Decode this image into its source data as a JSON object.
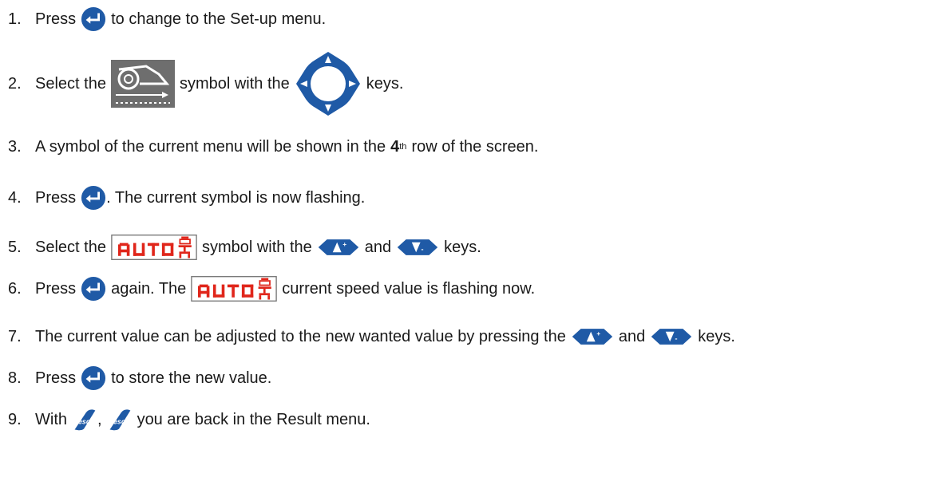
{
  "steps": [
    {
      "num": "1.",
      "a": "Press",
      "b": "to change to the Set-up menu."
    },
    {
      "num": "2.",
      "a": "Select the",
      "b": "symbol with the",
      "c": "keys."
    },
    {
      "num": "3.",
      "a": "A symbol of the current menu will be shown in the",
      "b": "4",
      "c": "th",
      "d": "row of the screen."
    },
    {
      "num": "4.",
      "a": "Press",
      "b": ". The current symbol is now flashing."
    },
    {
      "num": "5.",
      "a": "Select the",
      "b": "symbol with the",
      "c": "and",
      "d": "keys."
    },
    {
      "num": "6.",
      "a": "Press",
      "b": "again. The",
      "c": "current speed value is flashing now."
    },
    {
      "num": "7.",
      "a": "The current value can be adjusted to the new wanted value by pressing the",
      "b": "and",
      "c": "keys."
    },
    {
      "num": "8.",
      "a": "Press",
      "b": "to store the new value."
    },
    {
      "num": "9.",
      "a": "With",
      "b": ",",
      "c": "you are back in the Result menu."
    }
  ],
  "icons": {
    "enter": "enter-key-icon",
    "menu_symbol": "tractor-wheel-menu-icon",
    "nav_pad": "navigation-pad-icon",
    "auto": "auto-speed-symbol",
    "up": "up-arrow-key-icon",
    "down": "down-arrow-key-icon",
    "esc": "esc-key-icon"
  },
  "labels": {
    "auto_text": "AUTO",
    "esc_text": "ESC"
  },
  "colors": {
    "key_blue": "#1f5aa6",
    "auto_red": "#e0261b",
    "menu_grey": "#6e6e6e"
  }
}
